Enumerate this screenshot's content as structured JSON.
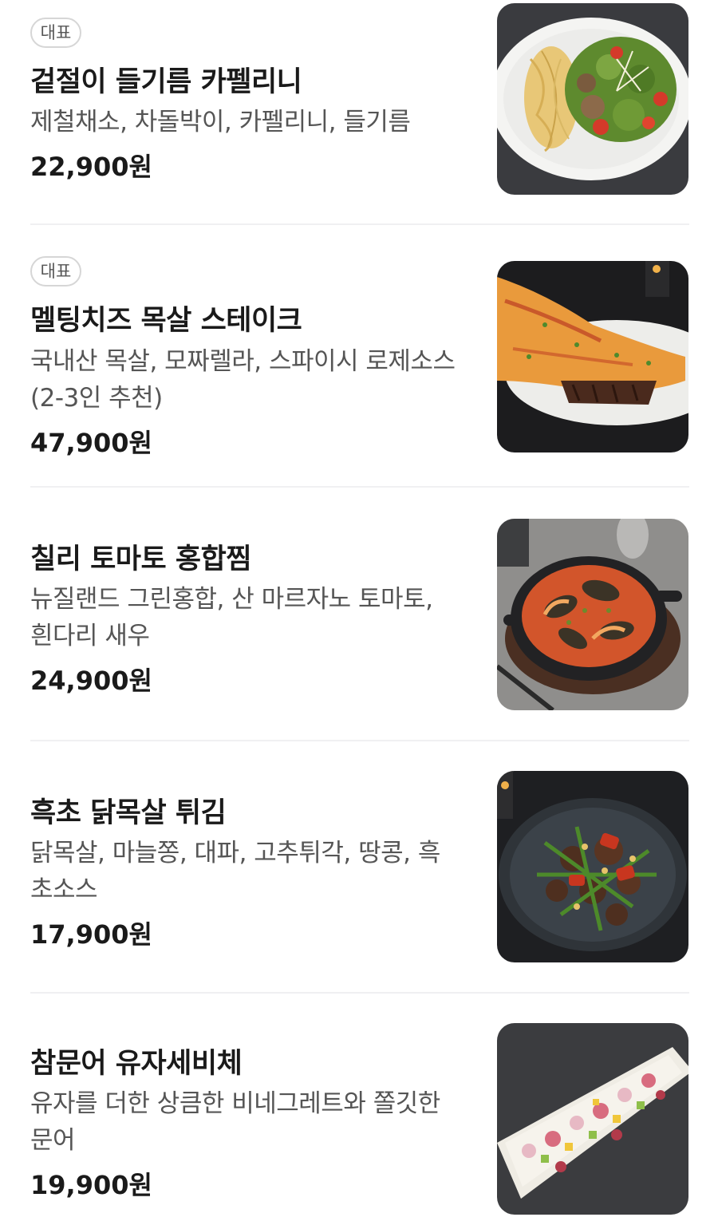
{
  "menu": {
    "items": [
      {
        "badge": "대표",
        "name": "겉절이 들기름 카펠리니",
        "description": "제철채소, 차돌박이, 카펠리니, 들기름",
        "price": "22,900원",
        "image_icon": "pasta-salad-plate-image"
      },
      {
        "badge": "대표",
        "name": "멜팅치즈 목살 스테이크",
        "description": "국내산 목살, 모짜렐라, 스파이시 로제소스(2-3인 추천)",
        "price": "47,900원",
        "image_icon": "cheese-steak-plate-image"
      },
      {
        "name": "칠리 토마토 홍합찜",
        "description": "뉴질랜드 그린홍합, 산 마르자노 토마토, 흰다리 새우",
        "price": "24,900원",
        "image_icon": "mussel-skillet-image"
      },
      {
        "name": "흑초 닭목살 튀김",
        "description": "닭목살, 마늘쫑, 대파, 고추튀각, 땅콩, 흑초소스",
        "price": "17,900원",
        "image_icon": "fried-chicken-plate-image"
      },
      {
        "name": "참문어 유자세비체",
        "description": "유자를 더한 상큼한 비네그레트와 쫄깃한 문어",
        "price": "19,900원",
        "image_icon": "octopus-ceviche-plate-image"
      }
    ]
  }
}
